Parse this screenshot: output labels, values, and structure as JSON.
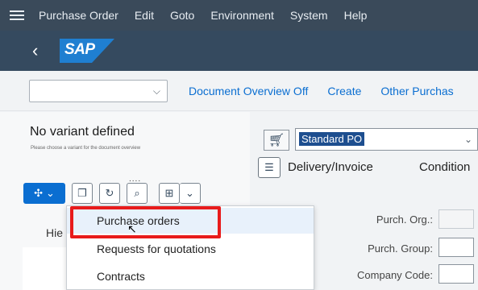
{
  "menubar": {
    "items": [
      {
        "label": "Purchase Order"
      },
      {
        "label": "Edit"
      },
      {
        "label": "Goto"
      },
      {
        "label": "Environment"
      },
      {
        "label": "System"
      },
      {
        "label": "Help"
      }
    ]
  },
  "shell": {
    "back_icon": "‹",
    "logo": "SAP",
    "logo_color": "#1f7fd1"
  },
  "toolbar": {
    "buttons": [
      {
        "label": "Document Overview Off"
      },
      {
        "label": "Create"
      },
      {
        "label": "Other Purchas"
      }
    ]
  },
  "left": {
    "variant_title": "No variant defined",
    "variant_hint": "Please choose a variant for the document overview",
    "dots": "....",
    "column_header": "Hie"
  },
  "dropdown": {
    "items": [
      {
        "label": "Purchase orders"
      },
      {
        "label": "Requests for quotations"
      },
      {
        "label": "Contracts"
      }
    ],
    "highlight_color": "#e81b1b"
  },
  "header": {
    "po_type": "Standard PO",
    "tab_delivery": "Delivery/Invoice",
    "tab_conditions": "Condition"
  },
  "fields": [
    {
      "label": "Purch. Org.:"
    },
    {
      "label": "Purch. Group:"
    },
    {
      "label": "Company Code:"
    }
  ],
  "colors": {
    "accent": "#0a6ed1",
    "shell": "#354a5f",
    "menubar": "#3a4a5a"
  }
}
